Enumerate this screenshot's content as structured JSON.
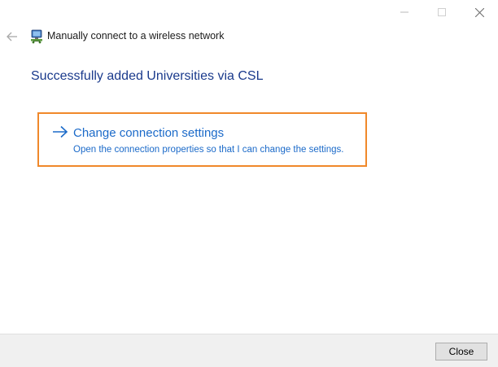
{
  "window": {
    "caption_buttons": {
      "minimize_icon": "minimize-icon",
      "maximize_icon": "maximize-icon",
      "close_icon": "close-icon"
    }
  },
  "header": {
    "back_icon": "back-arrow-icon",
    "app_icon": "network-wizard-icon",
    "title": "Manually connect to a wireless network"
  },
  "main": {
    "heading": "Successfully added Universities via CSL",
    "command_link": {
      "icon": "right-arrow-icon",
      "title": "Change connection settings",
      "description": "Open the connection properties so that I can change the settings.",
      "highlight_color": "#f0882a"
    }
  },
  "footer": {
    "close_label": "Close"
  },
  "colors": {
    "heading": "#1a3a8c",
    "link": "#1b6ac9",
    "highlight": "#f0882a",
    "footer_bg": "#f0f0f0"
  }
}
